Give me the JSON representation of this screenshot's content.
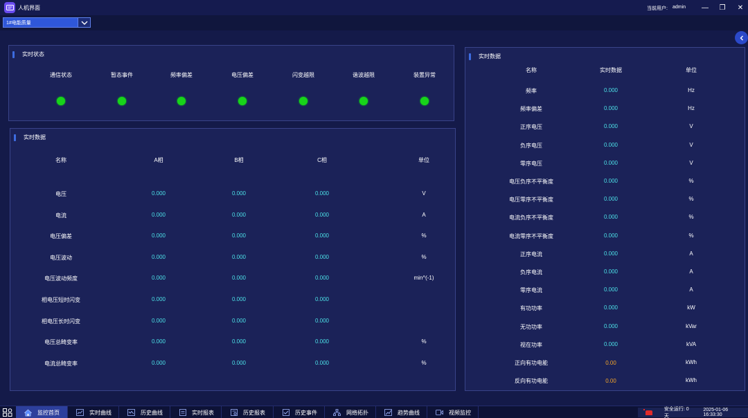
{
  "window": {
    "title": "人机界面",
    "user_label": "当前用户:",
    "user_name": "admin",
    "minimize": "—",
    "restore": "❐",
    "close": "✕"
  },
  "device_select": {
    "value": "1#电能质量"
  },
  "status_panel": {
    "title": "实时状态",
    "items": [
      {
        "label": "通信状态",
        "state": "ok"
      },
      {
        "label": "暂态事件",
        "state": "ok"
      },
      {
        "label": "频率偏差",
        "state": "ok"
      },
      {
        "label": "电压偏差",
        "state": "ok"
      },
      {
        "label": "闪变越限",
        "state": "ok"
      },
      {
        "label": "谐波越限",
        "state": "ok"
      },
      {
        "label": "装置异常",
        "state": "ok"
      }
    ],
    "ok_color": "#18d41a"
  },
  "phase_panel": {
    "title": "实时数据",
    "headers": [
      "名称",
      "A相",
      "B相",
      "C相",
      "单位"
    ],
    "rows": [
      {
        "name": "电压",
        "a": "0.000",
        "b": "0.000",
        "c": "0.000",
        "unit": "V"
      },
      {
        "name": "电流",
        "a": "0.000",
        "b": "0.000",
        "c": "0.000",
        "unit": "A"
      },
      {
        "name": "电压偏差",
        "a": "0.000",
        "b": "0.000",
        "c": "0.000",
        "unit": "%"
      },
      {
        "name": "电压波动",
        "a": "0.000",
        "b": "0.000",
        "c": "0.000",
        "unit": "%"
      },
      {
        "name": "电压波动频度",
        "a": "0.000",
        "b": "0.000",
        "c": "0.000",
        "unit": "min^(-1)"
      },
      {
        "name": "相电压短时闪变",
        "a": "0.000",
        "b": "0.000",
        "c": "0.000",
        "unit": ""
      },
      {
        "name": "相电压长时闪变",
        "a": "0.000",
        "b": "0.000",
        "c": "0.000",
        "unit": ""
      },
      {
        "name": "电压总畸变率",
        "a": "0.000",
        "b": "0.000",
        "c": "0.000",
        "unit": "%"
      },
      {
        "name": "电流总畸变率",
        "a": "0.000",
        "b": "0.000",
        "c": "0.000",
        "unit": "%"
      }
    ]
  },
  "summary_panel": {
    "title": "实时数据",
    "headers": [
      "名称",
      "实时数据",
      "单位"
    ],
    "rows": [
      {
        "name": "频率",
        "value": "0.000",
        "unit": "Hz",
        "highlight": false
      },
      {
        "name": "频率偏差",
        "value": "0.000",
        "unit": "Hz",
        "highlight": false
      },
      {
        "name": "正序电压",
        "value": "0.000",
        "unit": "V",
        "highlight": false
      },
      {
        "name": "负序电压",
        "value": "0.000",
        "unit": "V",
        "highlight": false
      },
      {
        "name": "零序电压",
        "value": "0.000",
        "unit": "V",
        "highlight": false
      },
      {
        "name": "电压负序不平衡度",
        "value": "0.000",
        "unit": "%",
        "highlight": false
      },
      {
        "name": "电压零序不平衡度",
        "value": "0.000",
        "unit": "%",
        "highlight": false
      },
      {
        "name": "电流负序不平衡度",
        "value": "0.000",
        "unit": "%",
        "highlight": false
      },
      {
        "name": "电流零序不平衡度",
        "value": "0.000",
        "unit": "%",
        "highlight": false
      },
      {
        "name": "正序电流",
        "value": "0.000",
        "unit": "A",
        "highlight": false
      },
      {
        "name": "负序电流",
        "value": "0.000",
        "unit": "A",
        "highlight": false
      },
      {
        "name": "零序电流",
        "value": "0.000",
        "unit": "A",
        "highlight": false
      },
      {
        "name": "有功功率",
        "value": "0.000",
        "unit": "kW",
        "highlight": false
      },
      {
        "name": "无功功率",
        "value": "0.000",
        "unit": "kVar",
        "highlight": false
      },
      {
        "name": "视在功率",
        "value": "0.000",
        "unit": "kVA",
        "highlight": false
      },
      {
        "name": "正向有功电能",
        "value": "0.00",
        "unit": "kWh",
        "highlight": true
      },
      {
        "name": "反向有功电能",
        "value": "0.00",
        "unit": "kWh",
        "highlight": true
      }
    ]
  },
  "nav": {
    "tabs": [
      {
        "label": "监控首页",
        "icon": "home-icon",
        "active": true
      },
      {
        "label": "实时曲线",
        "icon": "line-chart-icon",
        "active": false
      },
      {
        "label": "历史曲线",
        "icon": "history-chart-icon",
        "active": false
      },
      {
        "label": "实时报表",
        "icon": "report-icon",
        "active": false
      },
      {
        "label": "历史报表",
        "icon": "history-report-icon",
        "active": false
      },
      {
        "label": "历史事件",
        "icon": "event-icon",
        "active": false
      },
      {
        "label": "网络拓扑",
        "icon": "topology-icon",
        "active": false
      },
      {
        "label": "趋势曲线",
        "icon": "trend-icon",
        "active": false
      },
      {
        "label": "视频监控",
        "icon": "video-icon",
        "active": false
      }
    ]
  },
  "status_bar": {
    "alarm_icon": "alarm-icon",
    "safe_run": "安全运行: 0 天",
    "datetime": "2025-01-06 16:33:30"
  }
}
